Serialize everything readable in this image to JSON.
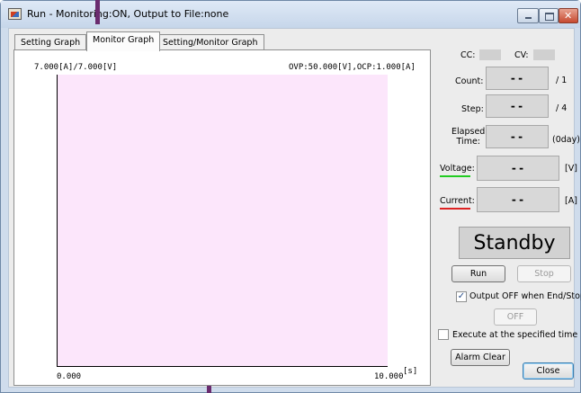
{
  "window": {
    "title": "Run - Monitoring:ON, Output to File:none"
  },
  "tabs": [
    {
      "label": "Setting Graph"
    },
    {
      "label": "Monitor Graph"
    },
    {
      "label": "Setting/Monitor Graph"
    }
  ],
  "chart": {
    "top_left_label": "7.000[A]/7.000[V]",
    "top_right_label": "OVP:50.000[V],OCP:1.000[A]",
    "x_min_label": "0.000",
    "x_max_label": "10.000",
    "x_unit": "[s]",
    "background_color": "#fce6fb"
  },
  "chart_data": {
    "type": "line",
    "series": [],
    "xlim": [
      0.0,
      10.0
    ],
    "xlabel": "[s]",
    "tick_labels": [
      "0.000",
      "10.000"
    ],
    "annotations": [
      "7.000[A]/7.000[V]",
      "OVP:50.000[V],OCP:1.000[A]"
    ],
    "grid": false
  },
  "status": {
    "cc_label": "CC:",
    "cv_label": "CV:",
    "count_label": "Count:",
    "count_value": "--",
    "count_total": "/ 1",
    "step_label": "Step:",
    "step_value": "--",
    "step_total": "/ 4",
    "elapsed_label_line1": "Elapsed",
    "elapsed_label_line2": "Time:",
    "elapsed_value": "--",
    "elapsed_day": "(0day)",
    "voltage_label": "Voltage:",
    "voltage_value": "--",
    "voltage_unit": "[V]",
    "voltage_color": "#22cc22",
    "current_label": "Current:",
    "current_value": "--",
    "current_unit": "[A]",
    "current_color": "#dd2222",
    "state": "Standby"
  },
  "controls": {
    "run_label": "Run",
    "stop_label": "Stop",
    "output_off_label": "Output OFF when End/Stop",
    "output_off_checked": true,
    "off_label": "OFF",
    "execute_label": "Execute at the specified time",
    "execute_checked": false,
    "alarm_clear_label": "Alarm Clear",
    "close_label": "Close"
  }
}
